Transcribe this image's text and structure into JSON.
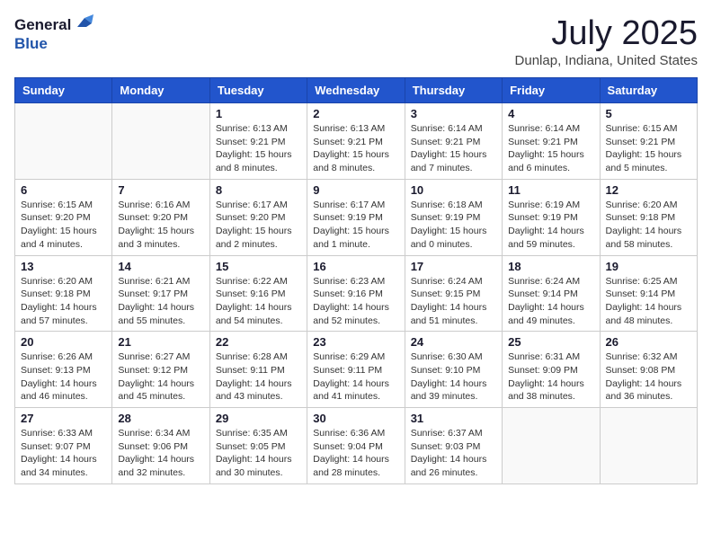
{
  "header": {
    "logo_general": "General",
    "logo_blue": "Blue",
    "month_year": "July 2025",
    "location": "Dunlap, Indiana, United States"
  },
  "weekdays": [
    "Sunday",
    "Monday",
    "Tuesday",
    "Wednesday",
    "Thursday",
    "Friday",
    "Saturday"
  ],
  "weeks": [
    [
      {
        "day": "",
        "info": ""
      },
      {
        "day": "",
        "info": ""
      },
      {
        "day": "1",
        "info": "Sunrise: 6:13 AM\nSunset: 9:21 PM\nDaylight: 15 hours\nand 8 minutes."
      },
      {
        "day": "2",
        "info": "Sunrise: 6:13 AM\nSunset: 9:21 PM\nDaylight: 15 hours\nand 8 minutes."
      },
      {
        "day": "3",
        "info": "Sunrise: 6:14 AM\nSunset: 9:21 PM\nDaylight: 15 hours\nand 7 minutes."
      },
      {
        "day": "4",
        "info": "Sunrise: 6:14 AM\nSunset: 9:21 PM\nDaylight: 15 hours\nand 6 minutes."
      },
      {
        "day": "5",
        "info": "Sunrise: 6:15 AM\nSunset: 9:21 PM\nDaylight: 15 hours\nand 5 minutes."
      }
    ],
    [
      {
        "day": "6",
        "info": "Sunrise: 6:15 AM\nSunset: 9:20 PM\nDaylight: 15 hours\nand 4 minutes."
      },
      {
        "day": "7",
        "info": "Sunrise: 6:16 AM\nSunset: 9:20 PM\nDaylight: 15 hours\nand 3 minutes."
      },
      {
        "day": "8",
        "info": "Sunrise: 6:17 AM\nSunset: 9:20 PM\nDaylight: 15 hours\nand 2 minutes."
      },
      {
        "day": "9",
        "info": "Sunrise: 6:17 AM\nSunset: 9:19 PM\nDaylight: 15 hours\nand 1 minute."
      },
      {
        "day": "10",
        "info": "Sunrise: 6:18 AM\nSunset: 9:19 PM\nDaylight: 15 hours\nand 0 minutes."
      },
      {
        "day": "11",
        "info": "Sunrise: 6:19 AM\nSunset: 9:19 PM\nDaylight: 14 hours\nand 59 minutes."
      },
      {
        "day": "12",
        "info": "Sunrise: 6:20 AM\nSunset: 9:18 PM\nDaylight: 14 hours\nand 58 minutes."
      }
    ],
    [
      {
        "day": "13",
        "info": "Sunrise: 6:20 AM\nSunset: 9:18 PM\nDaylight: 14 hours\nand 57 minutes."
      },
      {
        "day": "14",
        "info": "Sunrise: 6:21 AM\nSunset: 9:17 PM\nDaylight: 14 hours\nand 55 minutes."
      },
      {
        "day": "15",
        "info": "Sunrise: 6:22 AM\nSunset: 9:16 PM\nDaylight: 14 hours\nand 54 minutes."
      },
      {
        "day": "16",
        "info": "Sunrise: 6:23 AM\nSunset: 9:16 PM\nDaylight: 14 hours\nand 52 minutes."
      },
      {
        "day": "17",
        "info": "Sunrise: 6:24 AM\nSunset: 9:15 PM\nDaylight: 14 hours\nand 51 minutes."
      },
      {
        "day": "18",
        "info": "Sunrise: 6:24 AM\nSunset: 9:14 PM\nDaylight: 14 hours\nand 49 minutes."
      },
      {
        "day": "19",
        "info": "Sunrise: 6:25 AM\nSunset: 9:14 PM\nDaylight: 14 hours\nand 48 minutes."
      }
    ],
    [
      {
        "day": "20",
        "info": "Sunrise: 6:26 AM\nSunset: 9:13 PM\nDaylight: 14 hours\nand 46 minutes."
      },
      {
        "day": "21",
        "info": "Sunrise: 6:27 AM\nSunset: 9:12 PM\nDaylight: 14 hours\nand 45 minutes."
      },
      {
        "day": "22",
        "info": "Sunrise: 6:28 AM\nSunset: 9:11 PM\nDaylight: 14 hours\nand 43 minutes."
      },
      {
        "day": "23",
        "info": "Sunrise: 6:29 AM\nSunset: 9:11 PM\nDaylight: 14 hours\nand 41 minutes."
      },
      {
        "day": "24",
        "info": "Sunrise: 6:30 AM\nSunset: 9:10 PM\nDaylight: 14 hours\nand 39 minutes."
      },
      {
        "day": "25",
        "info": "Sunrise: 6:31 AM\nSunset: 9:09 PM\nDaylight: 14 hours\nand 38 minutes."
      },
      {
        "day": "26",
        "info": "Sunrise: 6:32 AM\nSunset: 9:08 PM\nDaylight: 14 hours\nand 36 minutes."
      }
    ],
    [
      {
        "day": "27",
        "info": "Sunrise: 6:33 AM\nSunset: 9:07 PM\nDaylight: 14 hours\nand 34 minutes."
      },
      {
        "day": "28",
        "info": "Sunrise: 6:34 AM\nSunset: 9:06 PM\nDaylight: 14 hours\nand 32 minutes."
      },
      {
        "day": "29",
        "info": "Sunrise: 6:35 AM\nSunset: 9:05 PM\nDaylight: 14 hours\nand 30 minutes."
      },
      {
        "day": "30",
        "info": "Sunrise: 6:36 AM\nSunset: 9:04 PM\nDaylight: 14 hours\nand 28 minutes."
      },
      {
        "day": "31",
        "info": "Sunrise: 6:37 AM\nSunset: 9:03 PM\nDaylight: 14 hours\nand 26 minutes."
      },
      {
        "day": "",
        "info": ""
      },
      {
        "day": "",
        "info": ""
      }
    ]
  ]
}
